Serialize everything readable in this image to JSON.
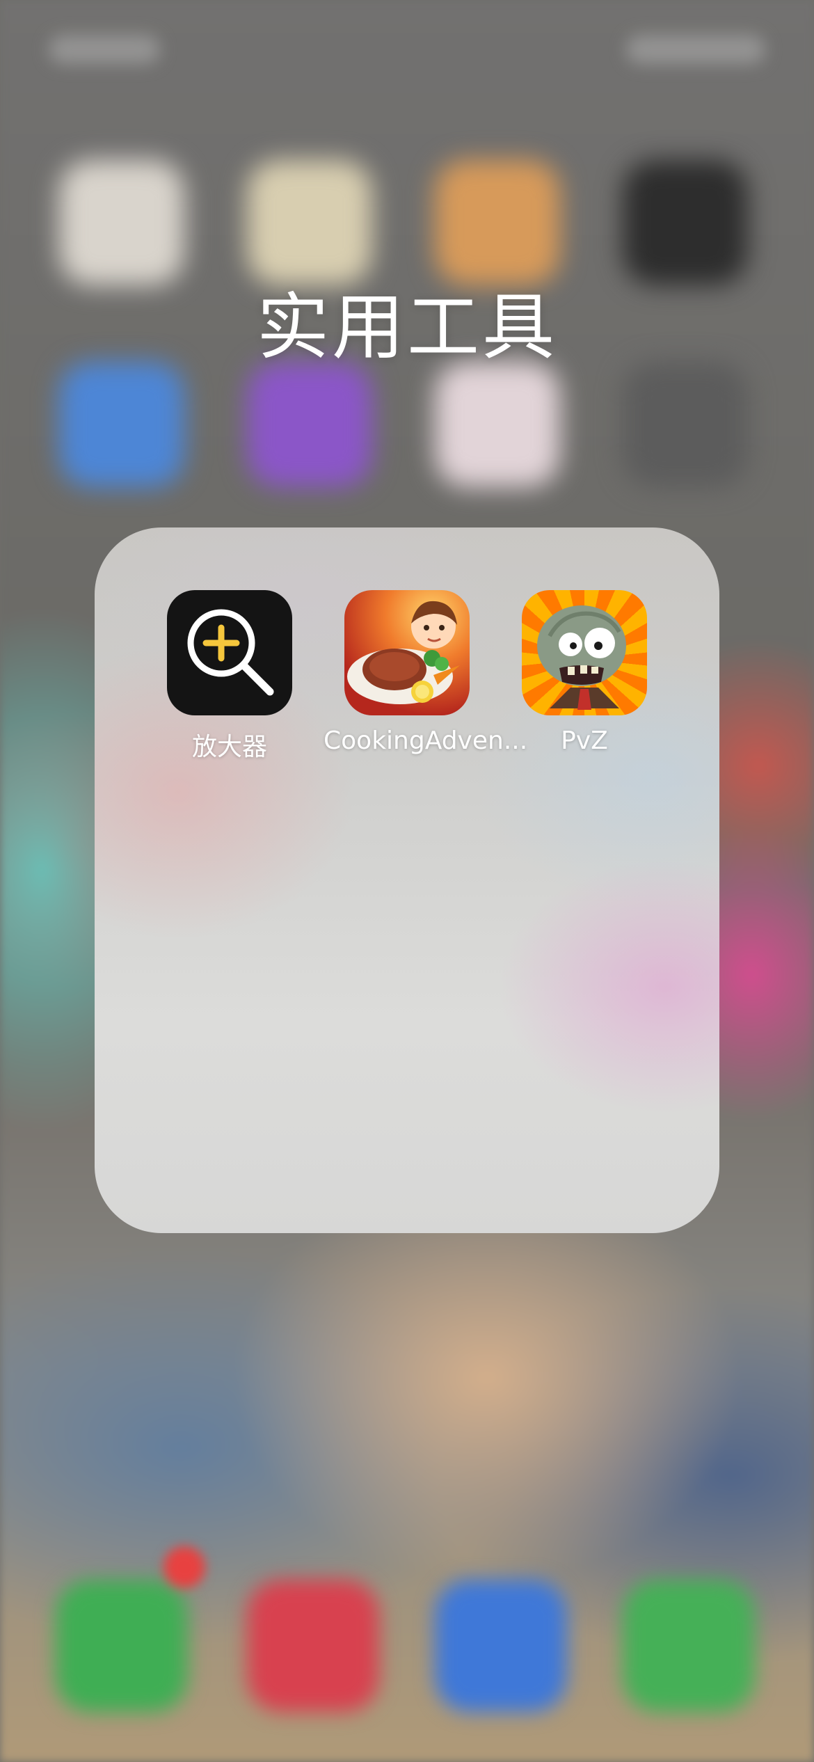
{
  "folder": {
    "title": "实用工具",
    "apps": [
      {
        "label": "放大器",
        "icon": "magnifier-icon"
      },
      {
        "label": "CookingAdven...",
        "icon": "cooking-adventure-icon"
      },
      {
        "label": "PvZ",
        "icon": "plants-vs-zombies-icon"
      }
    ]
  },
  "colors": {
    "magnifier_accent": "#F5C63C",
    "magnifier_background": "#141414",
    "label_text": "#FFFFFF"
  }
}
